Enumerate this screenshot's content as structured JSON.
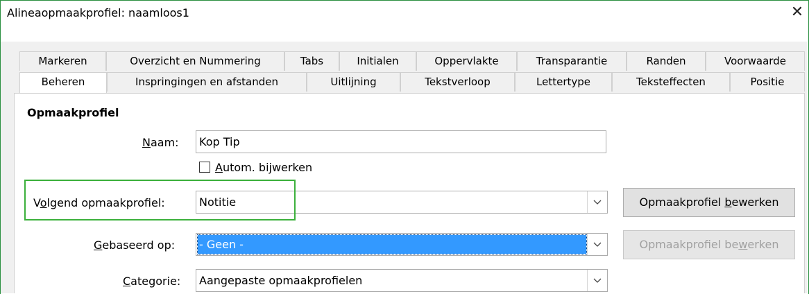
{
  "window": {
    "title": "Alineaopmaakprofiel: naamloos1",
    "close_symbol": "✕"
  },
  "tabs_row1": [
    {
      "label": "Markeren"
    },
    {
      "label": "Overzicht en Nummering"
    },
    {
      "label": "Tabs"
    },
    {
      "label": "Initialen"
    },
    {
      "label": "Oppervlakte"
    },
    {
      "label": "Transparantie"
    },
    {
      "label": "Randen"
    },
    {
      "label": "Voorwaarde"
    }
  ],
  "tabs_row2": [
    {
      "label": "Beheren"
    },
    {
      "label": "Inspringingen en afstanden"
    },
    {
      "label": "Uitlijning"
    },
    {
      "label": "Tekstverloop"
    },
    {
      "label": "Lettertype"
    },
    {
      "label": "Teksteffecten"
    },
    {
      "label": "Positie"
    }
  ],
  "active_tab": "Beheren",
  "section": {
    "title": "Opmaakprofiel"
  },
  "form": {
    "name": {
      "label_pre": "",
      "label_key": "N",
      "label_post": "aam:",
      "value": "Kop Tip"
    },
    "autoupdate": {
      "label_key": "A",
      "label_post": "utom. bijwerken",
      "checked": false
    },
    "next_style": {
      "label_pre": "V",
      "label_key": "o",
      "label_post": "lgend opmaakprofiel:",
      "value": "Notitie"
    },
    "based_on": {
      "label_pre": "",
      "label_key": "G",
      "label_post": "ebaseerd op:",
      "value": "- Geen -"
    },
    "category": {
      "label_pre": "",
      "label_key": "C",
      "label_post": "ategorie:",
      "value": "Aangepaste opmaakprofielen"
    }
  },
  "buttons": {
    "edit_next": {
      "pre": "Opmaakprofiel ",
      "key": "b",
      "post": "ewerken",
      "enabled": true
    },
    "edit_based": {
      "pre": "Opmaakprofiel be",
      "key": "w",
      "post": "erken",
      "enabled": false
    }
  },
  "icons": {
    "dropdown": "chevron-down-icon",
    "close": "close-icon",
    "checkbox": "checkbox-icon"
  },
  "colors": {
    "selection": "#3399ff",
    "highlight": "#3bb03b",
    "window_border": "#2a8f3f"
  }
}
